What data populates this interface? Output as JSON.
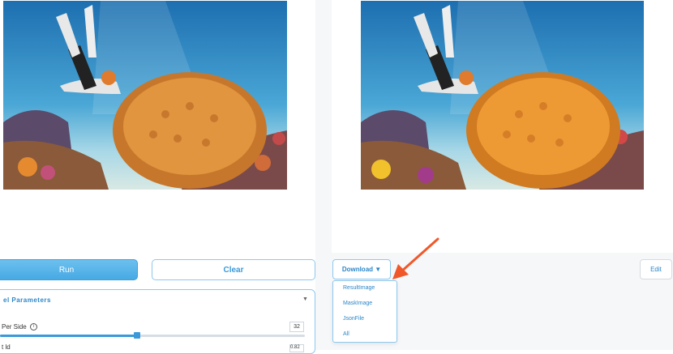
{
  "buttons": {
    "run": "Run",
    "clear": "Clear",
    "download": "Download ▼",
    "edit": "Edit"
  },
  "params": {
    "title": "el Parameters",
    "caret": "▼",
    "slider_label": "Per Side",
    "info_glyph": "i",
    "slider_value": "32",
    "slider_fraction": 0.45,
    "row2_label": "t    ld",
    "row2_value": "0.82"
  },
  "download_menu": {
    "items": [
      "ResultImage",
      "MaskImage",
      "JsonFile",
      "All"
    ]
  },
  "colors": {
    "accent": "#3a9ad9",
    "annotation_arrow": "#f0582a"
  },
  "icons": {
    "info": "info-icon",
    "caret": "chevron-down-icon",
    "annotation": "red-arrow-icon"
  }
}
